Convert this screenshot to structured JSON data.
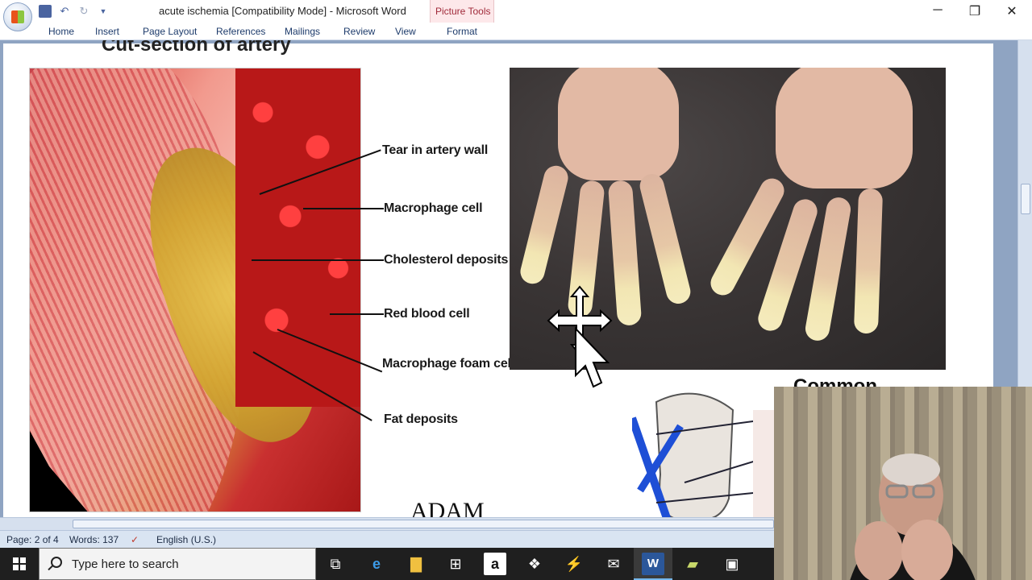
{
  "window": {
    "title": "acute ischemia [Compatibility Mode] - Microsoft Word",
    "contextual_group": "Picture Tools",
    "controls": {
      "minimize": "─",
      "restore": "❐",
      "close": "✕"
    }
  },
  "quick_access": {
    "save_icon": "save-icon",
    "undo_icon": "undo-icon",
    "redo_icon": "redo-icon",
    "customize_icon": "dropdown-icon"
  },
  "ribbon": {
    "tabs": [
      "Home",
      "Insert",
      "Page Layout",
      "References",
      "Mailings",
      "Review",
      "View",
      "Format"
    ]
  },
  "document": {
    "artery_heading": "Cut-section of artery",
    "artery_labels": [
      "Tear in artery wall",
      "Macrophage cell",
      "Cholesterol deposits",
      "Red blood cell",
      "Macrophage foam cell",
      "Fat deposits"
    ],
    "adam_logo": "ADAM",
    "common_heading": "Common"
  },
  "status": {
    "page": "Page: 2 of 4",
    "words": "Words: 137",
    "language": "English (U.S.)"
  },
  "taskbar": {
    "search_placeholder": "Type here to search",
    "icons": [
      "task-view-icon",
      "edge-icon",
      "file-explorer-icon",
      "store-icon",
      "amazon-icon",
      "dropbox-icon",
      "app-icon",
      "mail-icon",
      "word-icon",
      "notes-icon",
      "media-icon"
    ]
  },
  "colors": {
    "accent": "#2b579a",
    "picture_tools": "#a02a3a",
    "statusbar": "#d9e4f2",
    "taskbar": "#1f1f1f"
  }
}
